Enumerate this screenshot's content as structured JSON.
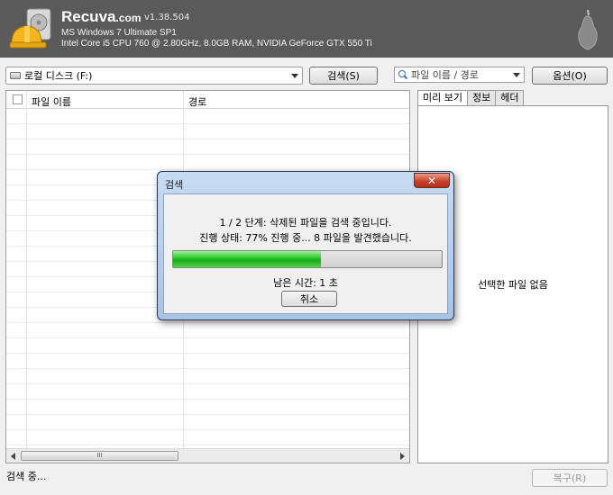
{
  "header": {
    "app_name": "Recuva",
    "app_domain": ".com",
    "version": "v1.38.504",
    "os_info": "MS Windows 7 Ultimate SP1",
    "hw_info": "Intel Core i5 CPU 760 @ 2.80GHz, 8.0GB RAM, NVIDIA GeForce GTX 550 Ti"
  },
  "toolbar": {
    "drive_value": "로컬 디스크 (F:)",
    "search_label": "검색(S)",
    "filter_value": "파일 이름 / 경로",
    "options_label": "옵션(O)"
  },
  "file_list": {
    "columns": [
      "파일 이름",
      "경로"
    ],
    "scroll_thumb_label": "III"
  },
  "info_panel": {
    "tabs": [
      "미리 보기",
      "정보",
      "헤더"
    ],
    "active_tab": 0,
    "empty_text": "선택한 파일 없음"
  },
  "dialog": {
    "title": "검색",
    "close_label": "✕",
    "message_line1": "1 / 2 단계: 삭제된 파일을 검색 중입니다.",
    "message_line2": "진행 상태: 77% 진행 중... 8 파일을 발견했습니다.",
    "progress_fraction": 0.55,
    "remaining_text": "남은 시간: 1 초",
    "cancel_label": "취소"
  },
  "status": {
    "text": "검색 중...",
    "restore_label": "복구(R)"
  },
  "colors": {
    "header_bg": "#5a5a5a",
    "progress_green": "#24c624",
    "close_red": "#c9432b"
  }
}
